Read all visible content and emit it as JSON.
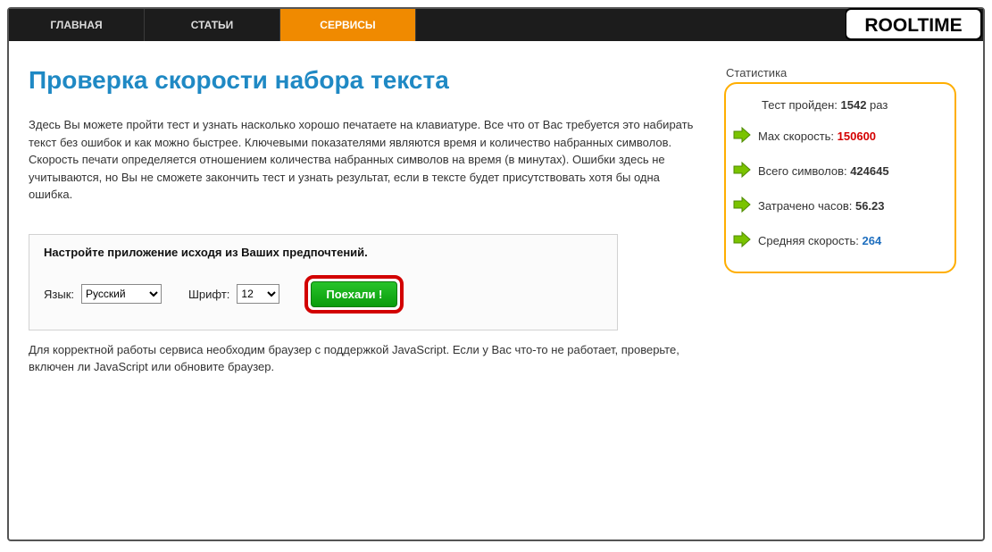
{
  "nav": {
    "items": [
      "ГЛАВНАЯ",
      "СТАТЬИ",
      "СЕРВИСЫ"
    ],
    "activeIndex": 2,
    "logo": "ROOLTIME"
  },
  "page": {
    "title": "Проверка скорости набора текста",
    "intro": " Здесь Вы можете пройти тест и узнать насколько хорошо печатаете на клавиатуре. Все что от Вас требуется это набирать текст без ошибок и как можно быстрее. Ключевыми показателями являются время и количество набранных символов. Скорость печати определяется отношением количества набранных символов на время (в минутах). Ошибки здесь не учитываются, но Вы не сможете закончить тест и узнать результат, если в тексте будет присутствовать хотя бы одна ошибка.",
    "footnote": "Для корректной работы сервиса необходим браузер с поддержкой JavaScript. Если у Вас что-то не работает, проверьте, включен ли JavaScript или обновите браузер."
  },
  "settings": {
    "heading": "Настройте приложение исходя из Ваших предпочтений.",
    "langLabel": "Язык:",
    "langValue": "Русский",
    "fontLabel": "Шрифт:",
    "fontValue": "12",
    "goLabel": "Поехали !"
  },
  "stats": {
    "title": "Статистика",
    "items": [
      {
        "icon": false,
        "label": "Тест пройден: ",
        "value": "1542",
        "suffix": " раз",
        "cls": ""
      },
      {
        "icon": true,
        "label": "Max скорость: ",
        "value": "150600",
        "suffix": "",
        "cls": "red"
      },
      {
        "icon": true,
        "label": "Всего символов: ",
        "value": "424645",
        "suffix": "",
        "cls": ""
      },
      {
        "icon": true,
        "label": "Затрачено часов: ",
        "value": "56.23",
        "suffix": "",
        "cls": ""
      },
      {
        "icon": true,
        "label": "Средняя скорость: ",
        "value": "264",
        "suffix": "",
        "cls": "blue"
      }
    ]
  }
}
